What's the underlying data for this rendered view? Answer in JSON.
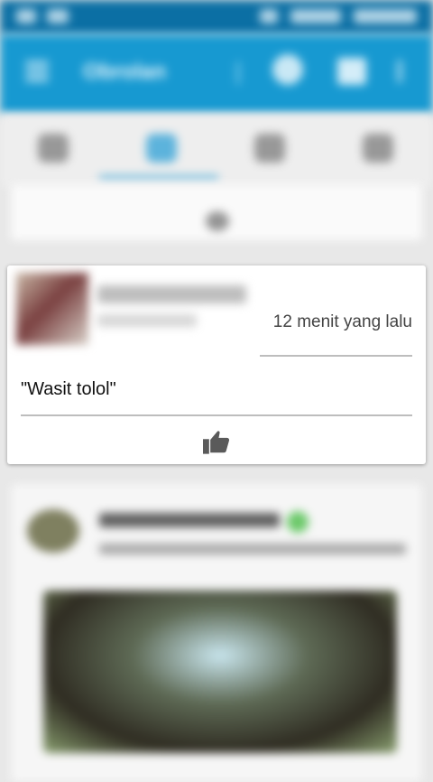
{
  "appbar": {
    "title": "Obrolan"
  },
  "tabs": [
    {
      "icon": "globe-icon"
    },
    {
      "icon": "chat-icon",
      "active": true
    },
    {
      "icon": "person-icon"
    },
    {
      "icon": "notification-icon"
    }
  ],
  "post": {
    "timestamp": "12 menit yang lalu",
    "comment": "\"Wasit tolol\"",
    "like_icon": "thumbs-up-icon"
  },
  "colors": {
    "appbar": "#1799d1",
    "statusbar": "#0b6fa4",
    "accent": "#2b9fd6"
  }
}
